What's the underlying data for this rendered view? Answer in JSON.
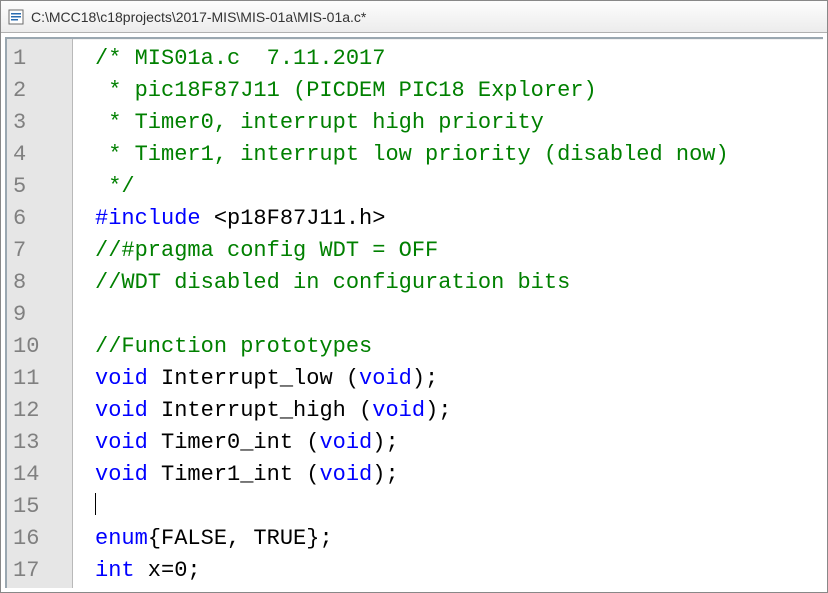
{
  "window": {
    "title": "C:\\MCC18\\c18projects\\2017-MIS\\MIS-01a\\MIS-01a.c*",
    "icon": "c-source-icon"
  },
  "editor": {
    "lines": [
      {
        "n": 1,
        "tokens": [
          {
            "cls": "c-comment",
            "t": "/* MIS01a.c  7.11.2017"
          }
        ]
      },
      {
        "n": 2,
        "tokens": [
          {
            "cls": "c-comment",
            "t": " * pic18F87J11 (PICDEM PIC18 Explorer)"
          }
        ]
      },
      {
        "n": 3,
        "tokens": [
          {
            "cls": "c-comment",
            "t": " * Timer0, interrupt high priority"
          }
        ]
      },
      {
        "n": 4,
        "tokens": [
          {
            "cls": "c-comment",
            "t": " * Timer1, interrupt low priority (disabled now)"
          }
        ]
      },
      {
        "n": 5,
        "tokens": [
          {
            "cls": "c-comment",
            "t": " */"
          }
        ]
      },
      {
        "n": 6,
        "tokens": [
          {
            "cls": "c-pre",
            "t": "#include "
          },
          {
            "cls": "c-plain",
            "t": "<p18F87J11.h>"
          }
        ]
      },
      {
        "n": 7,
        "tokens": [
          {
            "cls": "c-comment",
            "t": "//#pragma config WDT = OFF"
          }
        ]
      },
      {
        "n": 8,
        "tokens": [
          {
            "cls": "c-comment",
            "t": "//WDT disabled in configuration bits"
          }
        ]
      },
      {
        "n": 9,
        "tokens": [
          {
            "cls": "c-plain",
            "t": ""
          }
        ]
      },
      {
        "n": 10,
        "tokens": [
          {
            "cls": "c-comment",
            "t": "//Function prototypes"
          }
        ]
      },
      {
        "n": 11,
        "tokens": [
          {
            "cls": "c-kw",
            "t": "void"
          },
          {
            "cls": "c-plain",
            "t": " Interrupt_low ("
          },
          {
            "cls": "c-kw",
            "t": "void"
          },
          {
            "cls": "c-plain",
            "t": ");"
          }
        ]
      },
      {
        "n": 12,
        "tokens": [
          {
            "cls": "c-kw",
            "t": "void"
          },
          {
            "cls": "c-plain",
            "t": " Interrupt_high ("
          },
          {
            "cls": "c-kw",
            "t": "void"
          },
          {
            "cls": "c-plain",
            "t": ");"
          }
        ]
      },
      {
        "n": 13,
        "tokens": [
          {
            "cls": "c-kw",
            "t": "void"
          },
          {
            "cls": "c-plain",
            "t": " Timer0_int ("
          },
          {
            "cls": "c-kw",
            "t": "void"
          },
          {
            "cls": "c-plain",
            "t": ");"
          }
        ]
      },
      {
        "n": 14,
        "tokens": [
          {
            "cls": "c-kw",
            "t": "void"
          },
          {
            "cls": "c-plain",
            "t": " Timer1_int ("
          },
          {
            "cls": "c-kw",
            "t": "void"
          },
          {
            "cls": "c-plain",
            "t": ");"
          }
        ]
      },
      {
        "n": 15,
        "tokens": [
          {
            "cls": "c-plain",
            "t": ""
          }
        ],
        "caret": true
      },
      {
        "n": 16,
        "tokens": [
          {
            "cls": "c-kw",
            "t": "enum"
          },
          {
            "cls": "c-plain",
            "t": "{FALSE, TRUE};"
          }
        ]
      },
      {
        "n": 17,
        "tokens": [
          {
            "cls": "c-kw",
            "t": "int"
          },
          {
            "cls": "c-plain",
            "t": " x=0;"
          }
        ]
      }
    ]
  }
}
